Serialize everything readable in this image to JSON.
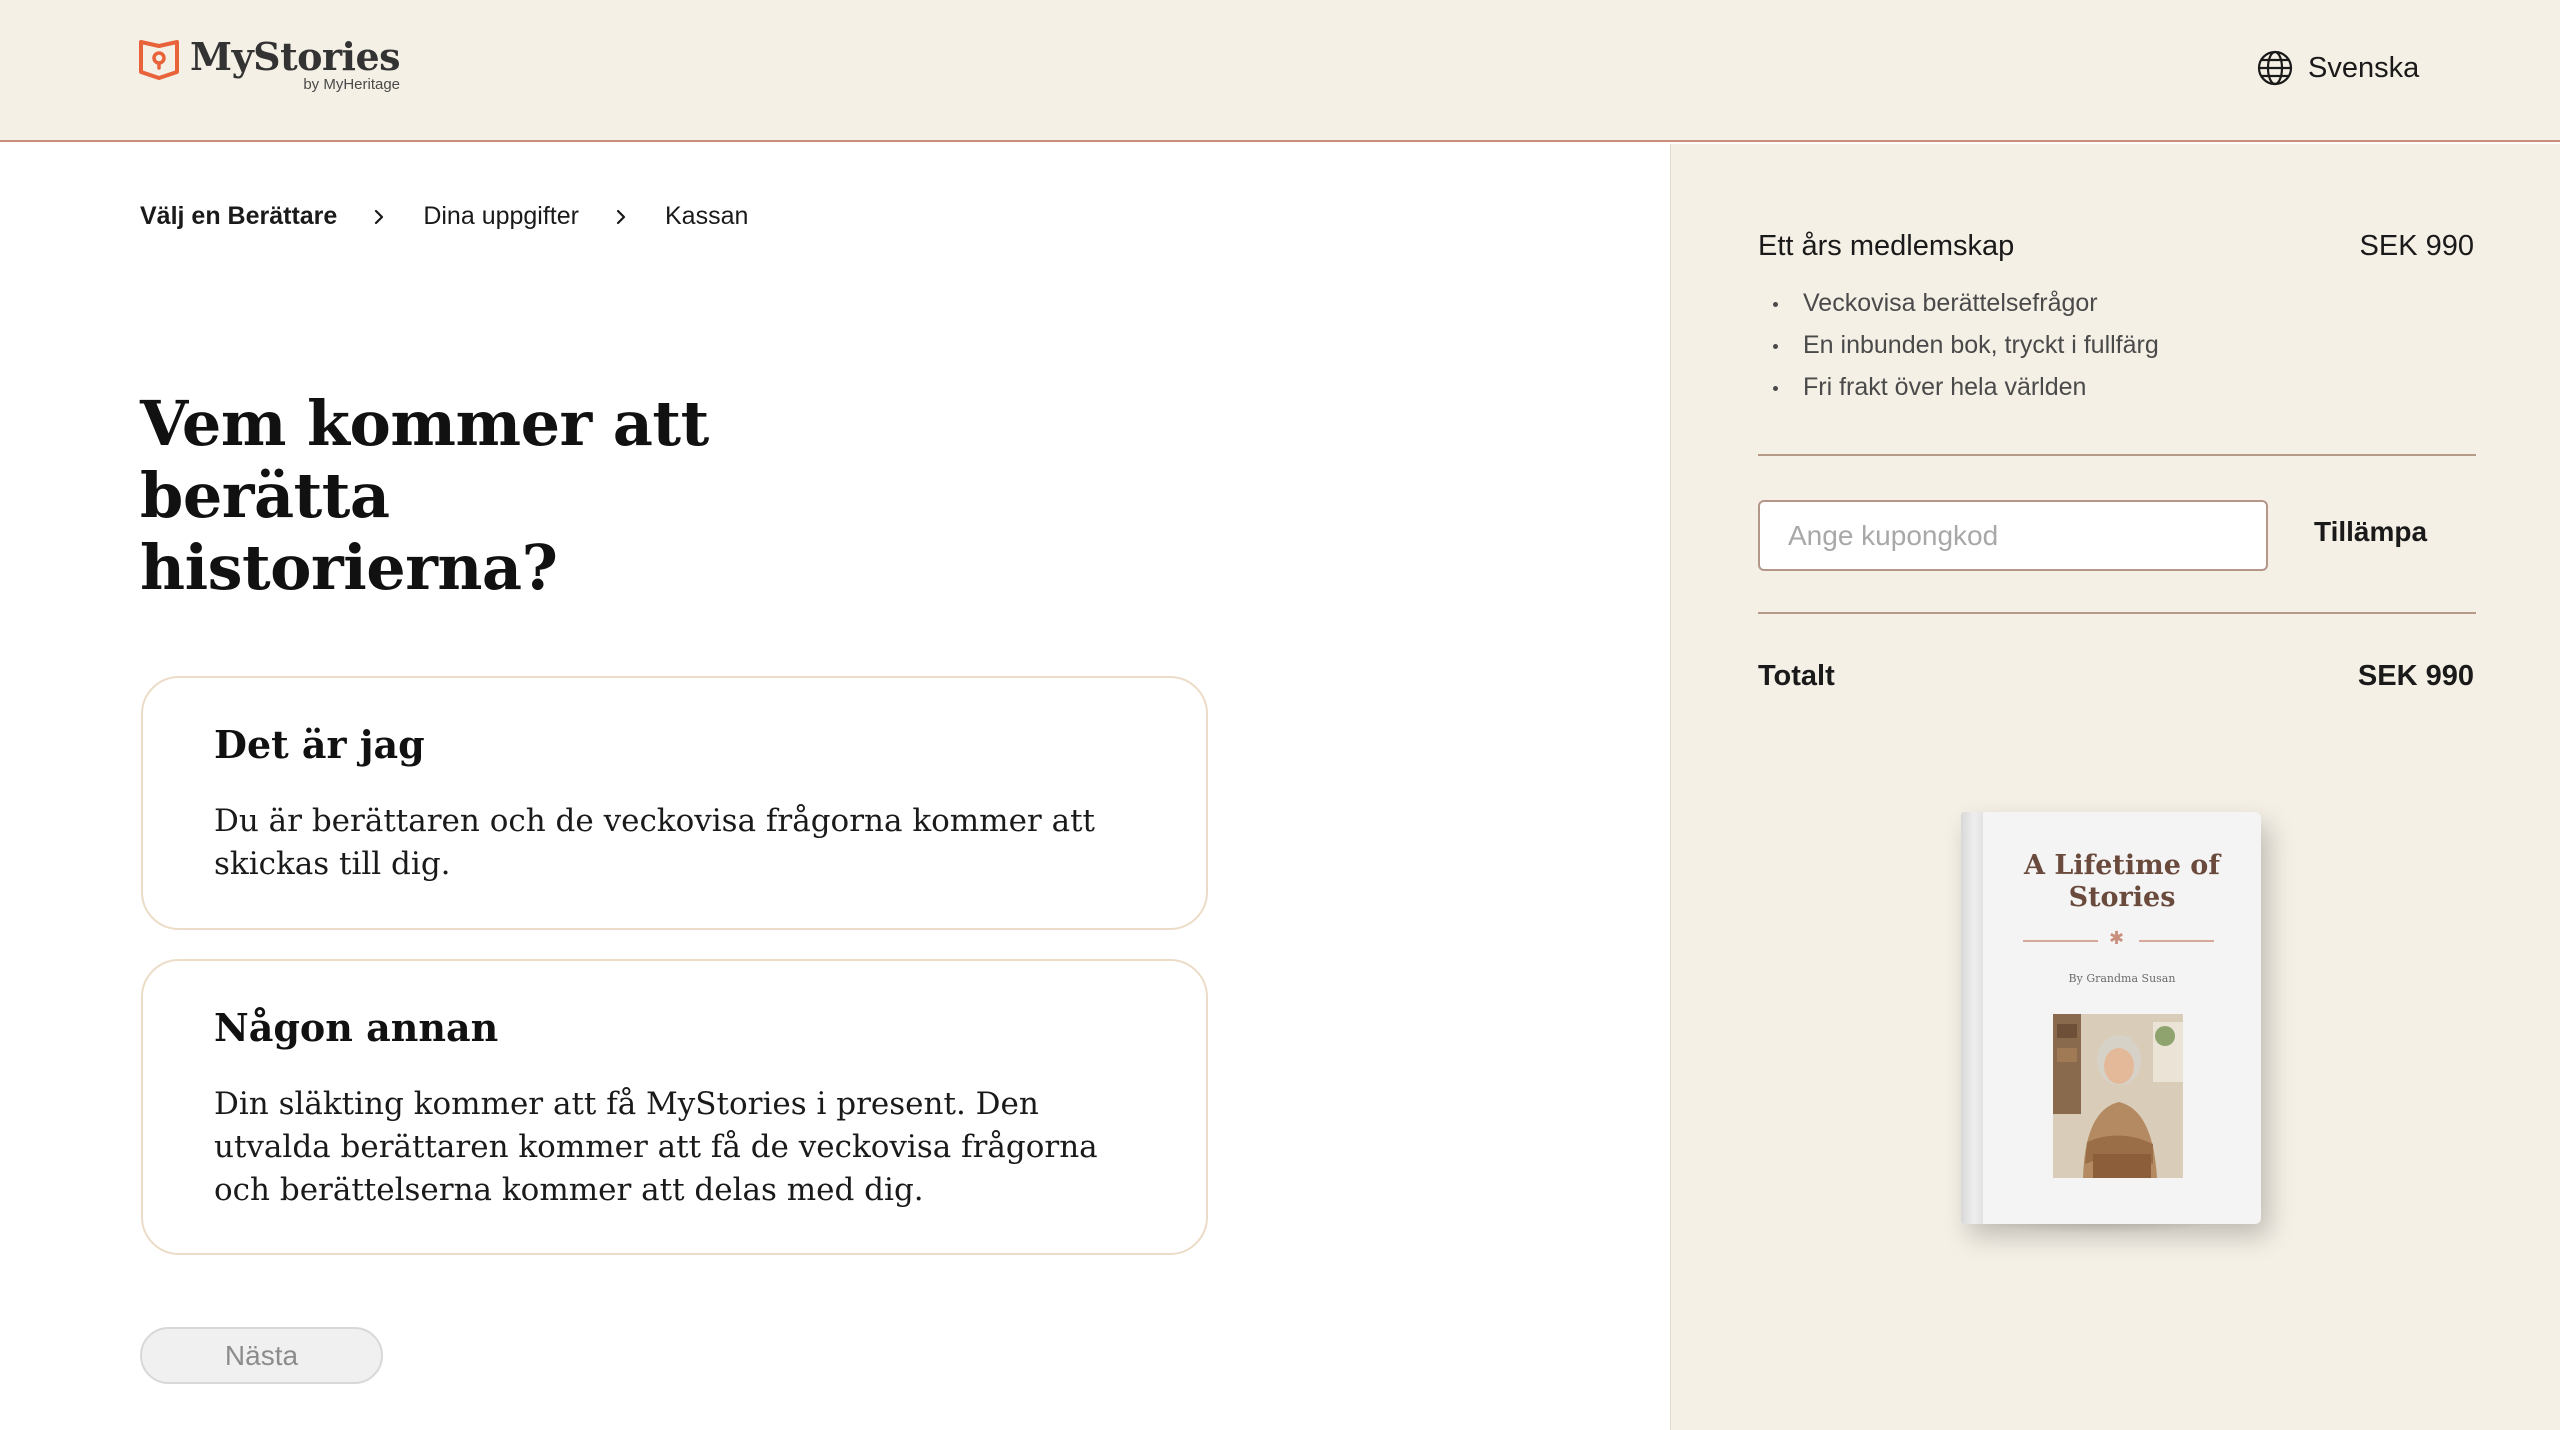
{
  "header": {
    "brand_name": "MyStories",
    "brand_sub": "by MyHeritage",
    "language": "Svenska"
  },
  "breadcrumb": {
    "step1": "Välj en Berättare",
    "step2": "Dina uppgifter",
    "step3": "Kassan"
  },
  "main": {
    "title": "Vem kommer att berätta historierna?",
    "options": [
      {
        "title": "Det är jag",
        "description": "Du är berättaren och de veckovisa frågorna kommer att skickas till dig."
      },
      {
        "title": "Någon annan",
        "description": "Din släkting kommer att få MyStories i present. Den utvalda berättaren kommer att få de veckovisa frågorna och berättelserna kommer att delas med dig."
      }
    ],
    "next_label": "Nästa"
  },
  "summary": {
    "plan_name": "Ett års medlemskap",
    "plan_price": "SEK 990",
    "features": [
      "Veckovisa berättelsefrågor",
      "En inbunden bok, tryckt i fullfärg",
      "Fri frakt över hela världen"
    ],
    "coupon_placeholder": "Ange kupongkod",
    "apply_label": "Tillämpa",
    "total_label": "Totalt",
    "total_price": "SEK 990"
  },
  "book": {
    "title": "A Lifetime of Stories",
    "author": "By Grandma Susan"
  },
  "colors": {
    "header_bg": "#f5f0e6",
    "brand_accent": "#e8623a",
    "card_border": "#ecdcc7",
    "divider": "#b49a87"
  }
}
